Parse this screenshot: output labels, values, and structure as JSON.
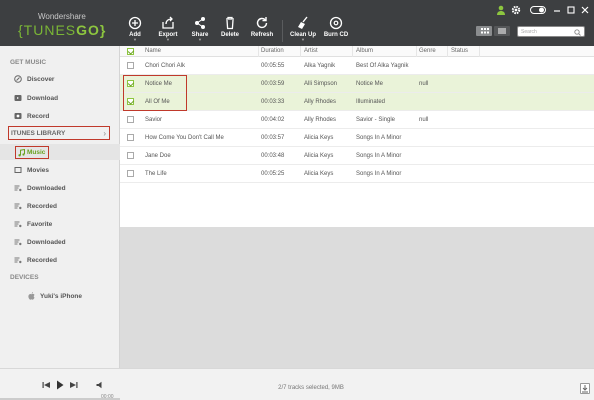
{
  "app": {
    "brand_small": "Wondershare",
    "brand_left": "{TUNES",
    "brand_right": "GO}"
  },
  "toolbar": {
    "add": "Add",
    "export": "Export",
    "share": "Share",
    "delete": "Delete",
    "refresh": "Refresh",
    "cleanup": "Clean Up",
    "burn": "Burn CD"
  },
  "search": {
    "placeholder": "Search"
  },
  "sidebar": {
    "get_music": "GET MUSIC",
    "discover": "Discover",
    "download": "Download",
    "record": "Record",
    "itunes_library": "ITUNES LIBRARY",
    "music": "Music",
    "movies": "Movies",
    "downloaded1": "Downloaded",
    "recorded1": "Recorded",
    "favorite": "Favorite",
    "downloaded2": "Downloaded",
    "recorded2": "Recorded",
    "devices": "DEVICES",
    "device_name": "Yuki's iPhone"
  },
  "table": {
    "columns": {
      "name": "Name",
      "duration": "Duration",
      "artist": "Artist",
      "album": "Album",
      "genre": "Genre",
      "status": "Status"
    },
    "rows": [
      {
        "name": "Chori Chori Alk",
        "duration": "00:05:55",
        "artist": "Alka Yagnik",
        "album": "Best Of Alka Yagnik",
        "genre": "",
        "checked": false
      },
      {
        "name": "Notice Me",
        "duration": "00:03:59",
        "artist": "Alli Simpson",
        "album": "Notice Me",
        "genre": "null",
        "checked": true
      },
      {
        "name": "All Of Me",
        "duration": "00:03:33",
        "artist": "Ally Rhodes",
        "album": "Illuminated",
        "genre": "",
        "checked": true
      },
      {
        "name": "Savior",
        "duration": "00:04:02",
        "artist": "Ally Rhodes",
        "album": "Savior - Single",
        "genre": "null",
        "checked": false
      },
      {
        "name": "How Come You Don't Call Me",
        "duration": "00:03:57",
        "artist": "Alicia Keys",
        "album": "Songs In A Minor",
        "genre": "",
        "checked": false
      },
      {
        "name": "Jane Doe",
        "duration": "00:03:48",
        "artist": "Alicia Keys",
        "album": "Songs In A Minor",
        "genre": "",
        "checked": false
      },
      {
        "name": "The Life",
        "duration": "00:05:25",
        "artist": "Alicia Keys",
        "album": "Songs In A Minor",
        "genre": "",
        "checked": false
      }
    ]
  },
  "player": {
    "time": "00:00",
    "progress": 0
  },
  "status": {
    "text": "2/7 tracks selected, 9MB"
  },
  "colors": {
    "accent": "#8dc63f",
    "titlebar": "#3d3f41",
    "highlight_border": "#c0392b",
    "selected_row": "#eaf3d9"
  }
}
